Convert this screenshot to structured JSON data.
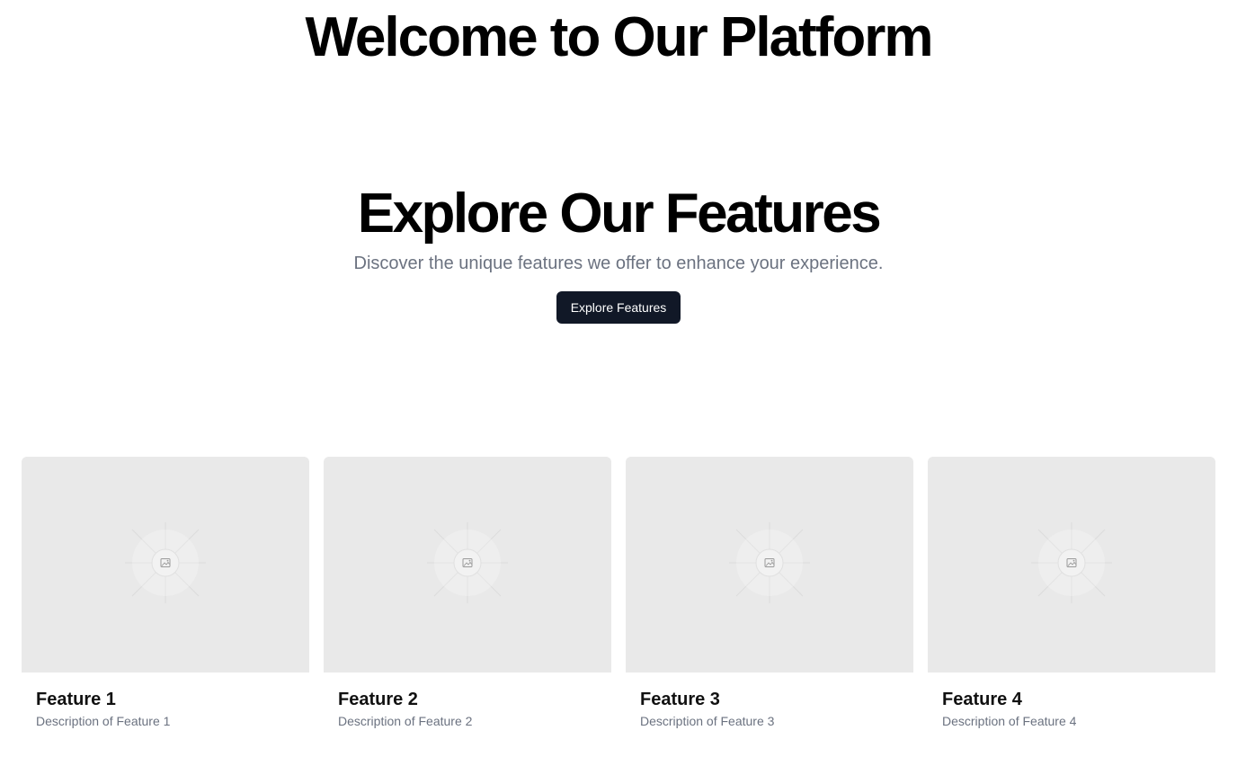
{
  "header": {
    "title": "Welcome to Our Platform"
  },
  "hero": {
    "title": "Explore Our Features",
    "subtitle": "Discover the unique features we offer to enhance your experience.",
    "button_label": "Explore Features"
  },
  "features": [
    {
      "title": "Feature 1",
      "description": "Description of Feature 1",
      "image_icon": "image-placeholder-icon"
    },
    {
      "title": "Feature 2",
      "description": "Description of Feature 2",
      "image_icon": "image-placeholder-icon"
    },
    {
      "title": "Feature 3",
      "description": "Description of Feature 3",
      "image_icon": "image-placeholder-icon"
    },
    {
      "title": "Feature 4",
      "description": "Description of Feature 4",
      "image_icon": "image-placeholder-icon"
    }
  ],
  "colors": {
    "button_bg": "#111827",
    "muted_text": "#6b7280",
    "placeholder_bg": "#e9e9e9"
  }
}
